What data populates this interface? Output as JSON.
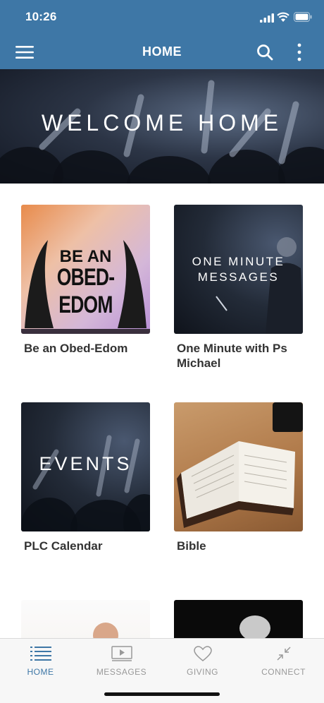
{
  "status": {
    "time": "10:26"
  },
  "nav": {
    "title": "HOME"
  },
  "hero": {
    "headline": "WELCOME HOME"
  },
  "cards": [
    {
      "label": "Be an Obed-Edom",
      "thumb_text_1": "BE AN",
      "thumb_text_2": "OBED-EDOM"
    },
    {
      "label": "One Minute with Ps Michael",
      "thumb_text_1": "ONE MINUTE MESSAGES"
    },
    {
      "label": "PLC Calendar",
      "thumb_text_1": "EVENTS"
    },
    {
      "label": "Bible"
    }
  ],
  "tabs": [
    {
      "label": "HOME",
      "icon": "list-icon",
      "active": true
    },
    {
      "label": "MESSAGES",
      "icon": "video-play-icon",
      "active": false
    },
    {
      "label": "GIVING",
      "icon": "heart-icon",
      "active": false
    },
    {
      "label": "CONNECT",
      "icon": "compress-arrows-icon",
      "active": false
    }
  ],
  "colors": {
    "brand": "#3e77a6",
    "tab_inactive": "#999999"
  }
}
